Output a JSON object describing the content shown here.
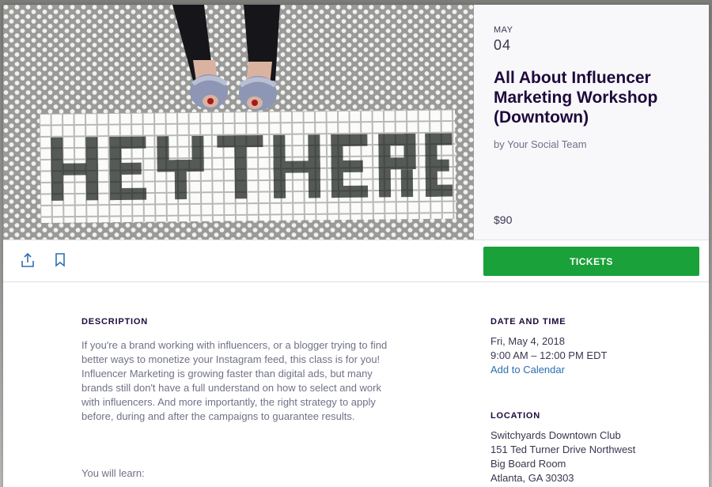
{
  "event": {
    "month": "MAY",
    "day": "04",
    "title": "All About Influencer Marketing Workshop (Downtown)",
    "organizer": "by Your Social Team",
    "price": "$90",
    "hero_tiles_text": "HEY THERE"
  },
  "actions": {
    "share_icon": "share-icon",
    "bookmark_icon": "bookmark-icon",
    "tickets_label": "TICKETS"
  },
  "description": {
    "heading": "DESCRIPTION",
    "paragraph_1": "If you're a brand working with influencers, or a blogger trying to find better ways to monetize your Instagram feed, this class is for you!",
    "paragraph_2": "Influencer Marketing is growing faster than digital ads, but many brands still don't have a full understand on how to select and work with influencers. And more importantly, the right strategy to apply before, during and after the campaigns to guarantee results.",
    "learn_label": "You will learn:"
  },
  "date_time": {
    "heading": "DATE AND TIME",
    "date": "Fri, May 4, 2018",
    "time": "9:00 AM – 12:00 PM EDT",
    "calendar_link": "Add to Calendar"
  },
  "location": {
    "heading": "LOCATION",
    "venue": "Switchyards Downtown Club",
    "street": "151 Ted Turner Drive Northwest",
    "room": "Big Board Room",
    "city": "Atlanta, GA 30303"
  },
  "colors": {
    "accent_green": "#1aa13a",
    "link_blue": "#2e6fb0",
    "title_dark": "#1e0a3c"
  }
}
